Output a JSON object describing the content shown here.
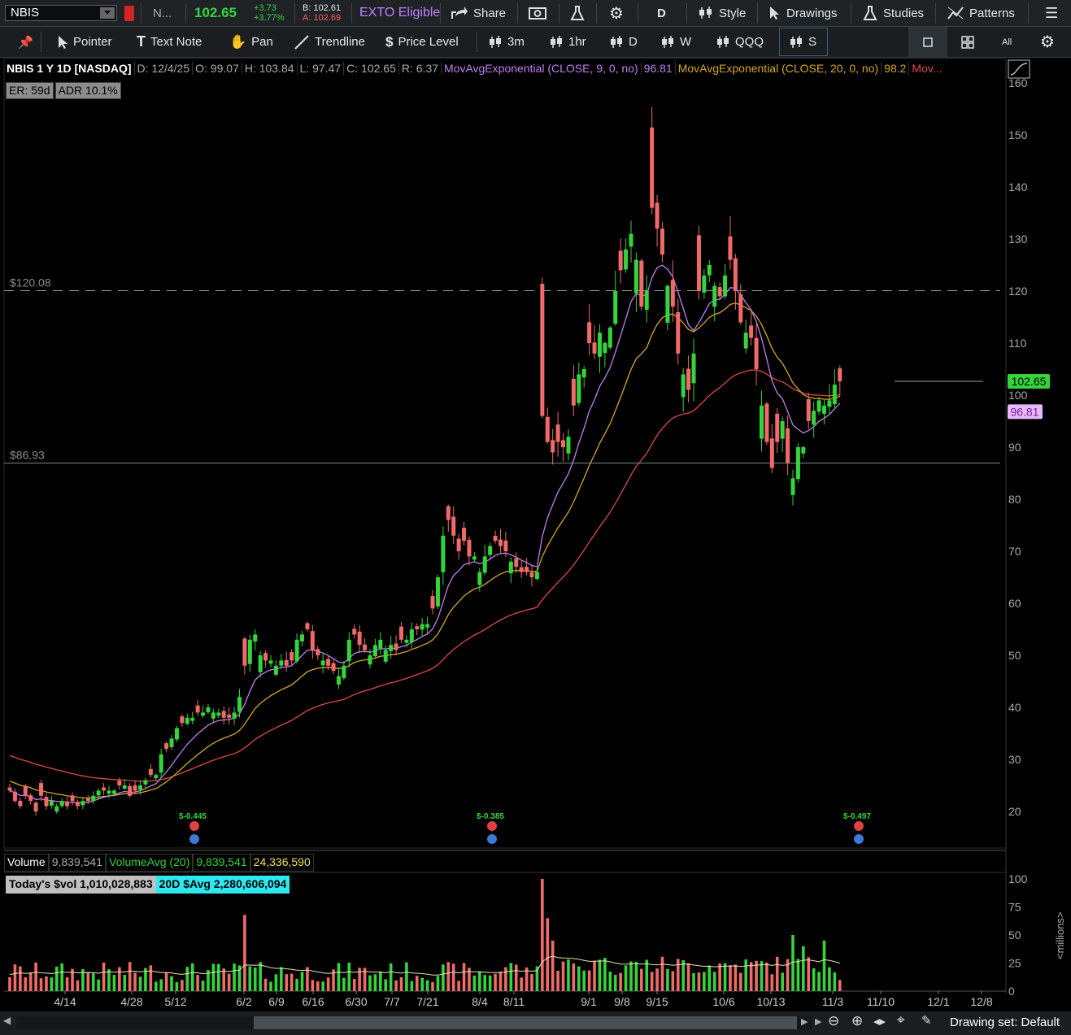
{
  "header": {
    "ticker": "NBIS",
    "name_trunc": "N...",
    "last": "102.65",
    "chg": "+3.73",
    "chg_pct": "+3.77%",
    "bid": "B: 102.61",
    "ask": "A: 102.69",
    "exto": "EXTO Eligible",
    "share": "Share",
    "period": "D",
    "style": "Style",
    "drawings": "Drawings",
    "studies": "Studies",
    "patterns": "Patterns"
  },
  "toolbar": {
    "pointer": "Pointer",
    "textnote": "Text Note",
    "pan": "Pan",
    "trendline": "Trendline",
    "pricelevel": "Price Level",
    "t3m": "3m",
    "t1hr": "1hr",
    "tD": "D",
    "tW": "W",
    "tQQQ": "QQQ",
    "tS": "S",
    "all": "All"
  },
  "legend": {
    "symbol": "NBIS 1 Y 1D [NASDAQ]",
    "date": "D: 12/4/25",
    "open": "O: 99.07",
    "high": "H: 103.84",
    "low": "L: 97.47",
    "close": "C: 102.65",
    "range": "R: 6.37",
    "ema9": "MovAvgExponential (CLOSE, 9, 0, no)",
    "ema9_val": "96.81",
    "ema20": "MovAvgExponential (CLOSE, 20, 0, no)",
    "ema20_val": "98.2",
    "mov": "Mov...",
    "er": "ER: 59d",
    "adr": "ADR 10.1%"
  },
  "volume_legend": {
    "vol": "Volume",
    "vol_val": "9,839,541",
    "avg": "VolumeAvg (20)",
    "avg_val": "9,839,541",
    "avg_val2": "24,336,590",
    "today": "Today's $vol 1,010,028,883",
    "avg20d": "20D $Avg 2,280,606,094"
  },
  "bottom": {
    "drawing_set": "Drawing set: Default"
  },
  "colors": {
    "up": "#35d43d",
    "down": "#f06a6a",
    "ema9": "#c080f0",
    "ema20": "#d4a62a",
    "ema50": "#e04a4a",
    "bg": "#000000",
    "toolbar": "#1f2326"
  },
  "chart_data": {
    "type": "candlestick",
    "price_axis": {
      "min": 15,
      "max": 165,
      "ticks": [
        20,
        30,
        40,
        50,
        60,
        70,
        80,
        90,
        100,
        110,
        120,
        130,
        140,
        150,
        160
      ]
    },
    "x_tick_labels": [
      "4/14",
      "4/28",
      "5/12",
      "6/2",
      "6/9",
      "6/16",
      "6/30",
      "7/7",
      "7/21",
      "8/4",
      "8/11",
      "9/1",
      "9/8",
      "9/15",
      "10/6",
      "10/13",
      "11/3",
      "11/10",
      "12/1",
      "12/8"
    ],
    "horizontal_levels": [
      {
        "label": "$120.08",
        "value": 120.08,
        "style": "dashed"
      },
      {
        "label": "$86.93",
        "value": 86.93,
        "style": "solid"
      }
    ],
    "last_price_label": "102.65",
    "ema9_label": "96.81",
    "earnings_markers": [
      {
        "label": "$-0.445"
      },
      {
        "label": "$-0.385"
      },
      {
        "label": "$-0.497"
      }
    ],
    "closes": [
      24,
      22,
      21,
      23,
      22,
      20,
      23,
      21,
      22,
      21,
      22,
      21,
      22,
      21,
      22,
      22,
      23,
      24,
      24,
      24,
      24,
      25,
      25,
      23,
      24,
      25,
      26,
      27,
      27,
      31,
      32,
      34,
      36,
      37,
      38,
      38,
      39,
      39,
      40,
      39,
      39,
      38,
      38,
      39,
      42,
      48,
      53,
      54,
      50,
      49,
      49,
      48,
      49,
      48,
      49,
      53,
      54,
      55,
      51,
      50,
      49,
      48,
      47,
      46,
      48,
      53,
      54,
      52,
      51,
      50,
      52,
      53,
      51,
      52,
      51,
      53,
      53,
      55,
      55,
      56,
      56,
      59,
      65,
      73,
      76,
      73,
      70,
      72,
      69,
      69,
      66,
      69,
      71,
      72,
      71,
      70,
      68,
      67,
      66,
      66,
      65,
      66,
      96,
      91,
      89,
      91,
      90,
      92,
      98,
      104,
      105,
      110,
      108,
      112,
      110,
      113,
      120,
      124,
      128,
      131,
      126,
      117,
      120,
      136,
      132,
      127,
      121,
      117,
      108,
      104,
      101,
      108,
      120,
      123,
      125,
      121,
      119,
      123,
      126,
      120,
      114,
      112,
      111,
      105,
      98,
      91,
      86,
      91,
      95,
      87,
      84,
      90,
      90,
      95,
      97,
      99,
      98,
      99,
      102,
      102.65
    ],
    "volume_axis": {
      "min": 0,
      "max": 100,
      "ticks": [
        0,
        25,
        50,
        75,
        100
      ],
      "unit": "millions"
    }
  }
}
